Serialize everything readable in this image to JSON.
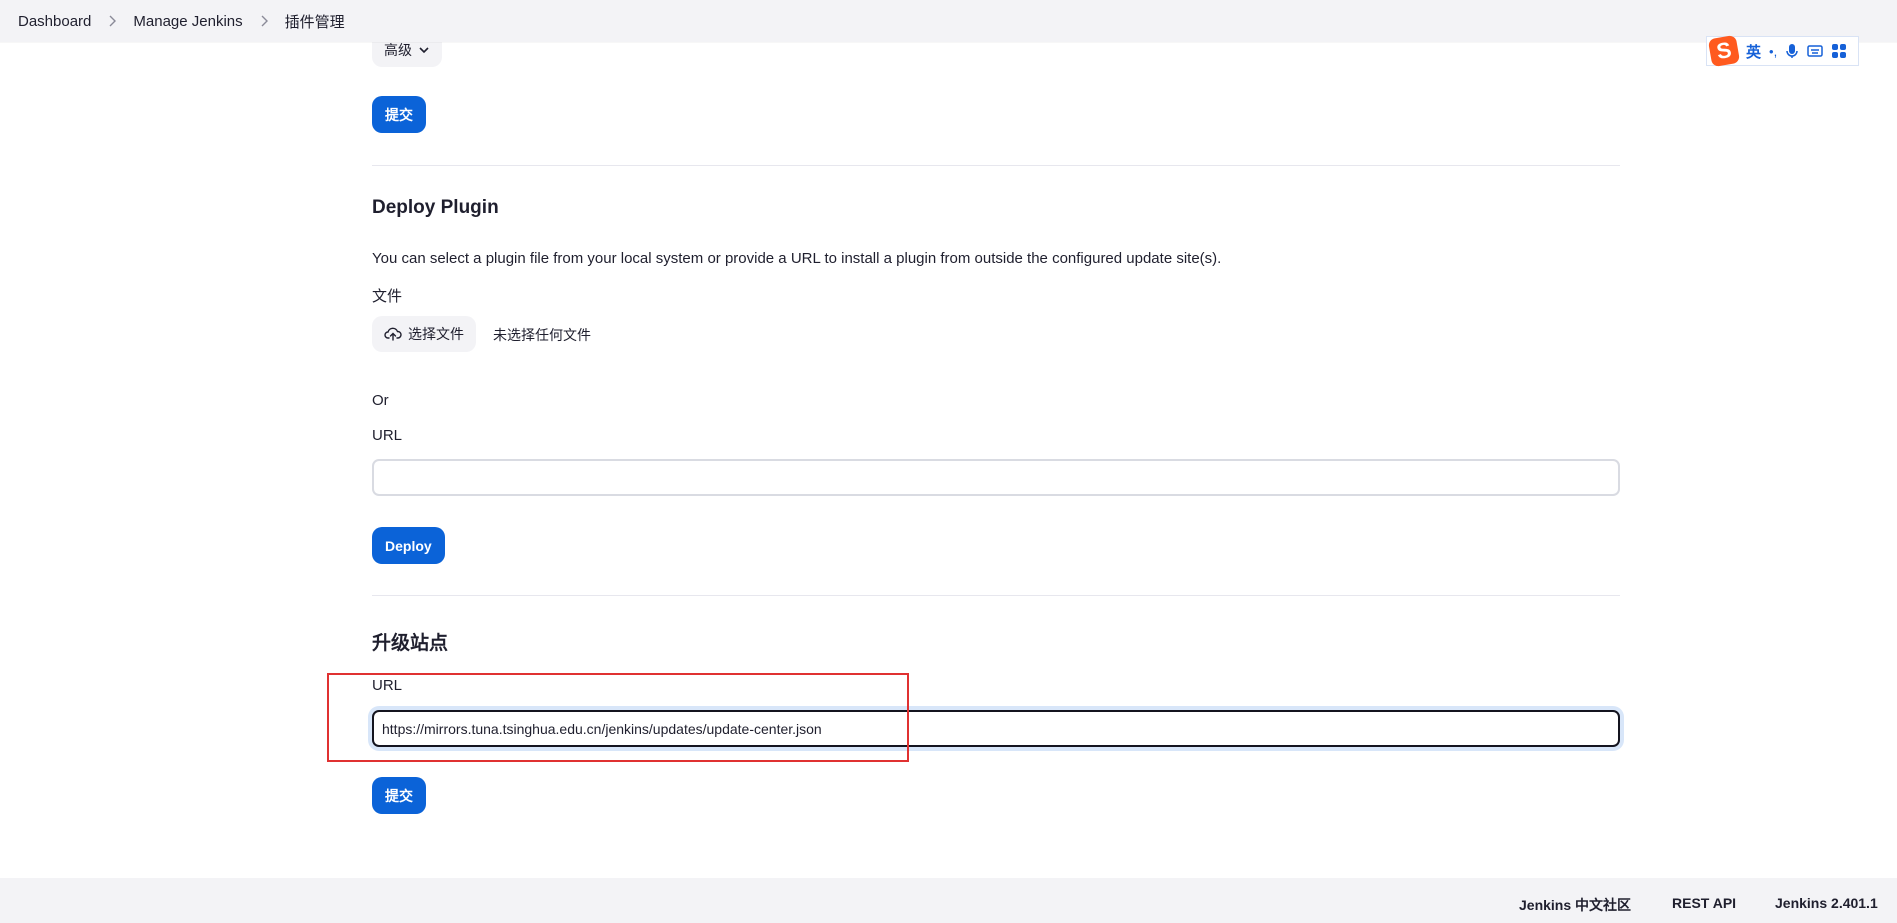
{
  "breadcrumb": {
    "items": [
      "Dashboard",
      "Manage Jenkins",
      "插件管理"
    ]
  },
  "ime_toolbar": {
    "logo": "S",
    "mode": "英",
    "punct": "•,",
    "icons": [
      "microphone-icon",
      "keyboard-icon",
      "grid-icon"
    ]
  },
  "advanced": {
    "label": "高级"
  },
  "top_submit": {
    "label": "提交"
  },
  "deploy_plugin": {
    "title": "Deploy Plugin",
    "description": "You can select a plugin file from your local system or provide a URL to install a plugin from outside the configured update site(s).",
    "file_label": "文件",
    "choose_file_button": "选择文件",
    "no_file_text": "未选择任何文件",
    "or_text": "Or",
    "url_label": "URL",
    "url_value": "",
    "deploy_button": "Deploy"
  },
  "update_site": {
    "title": "升级站点",
    "url_label": "URL",
    "url_value": "https://mirrors.tuna.tsinghua.edu.cn/jenkins/updates/update-center.json",
    "submit_button": "提交"
  },
  "footer": {
    "links": [
      "Jenkins 中文社区",
      "REST API",
      "Jenkins 2.401.1"
    ]
  },
  "colors": {
    "primary": "#0b63d8",
    "annotation": "#e03131"
  }
}
